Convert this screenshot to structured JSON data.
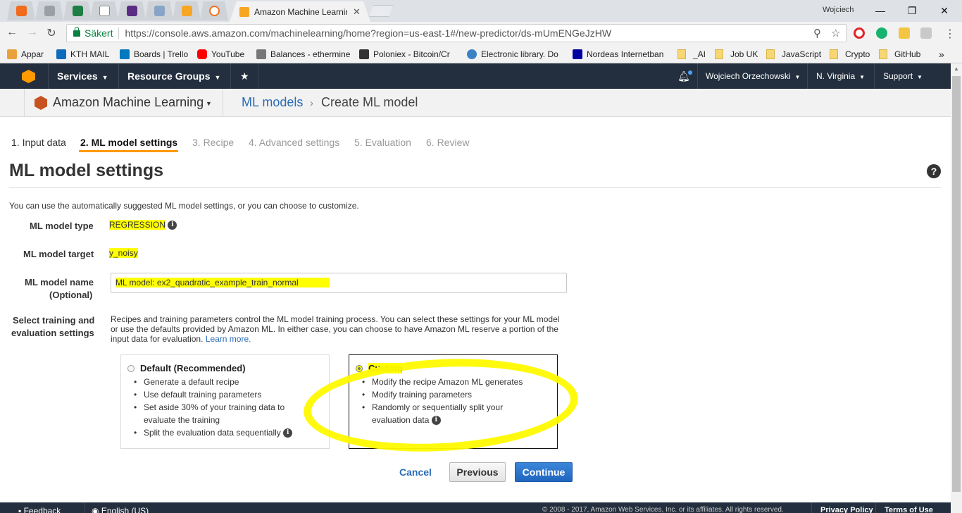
{
  "browser": {
    "active_tab_title": "Amazon Machine Learnin",
    "window_user": "Wojciech",
    "secure_label": "Säkert",
    "url": "https://console.aws.amazon.com/machinelearning/home?region=us-east-1#/new-predictor/ds-mUmENGeJzHW",
    "bookmarks": [
      {
        "label": "Appar",
        "icon_color": "#e9a23b"
      },
      {
        "label": "KTH MAIL",
        "icon_color": "#0f6cbd"
      },
      {
        "label": "Boards | Trello",
        "icon_color": "#0079bf"
      },
      {
        "label": "YouTube",
        "icon_color": "#ff0000"
      },
      {
        "label": "Balances - ethermine",
        "icon_color": "#777777"
      },
      {
        "label": "Poloniex - Bitcoin/Cr",
        "icon_color": "#333333"
      },
      {
        "label": "Electronic library. Do",
        "icon_color": "#3b82c4"
      },
      {
        "label": "Nordeas Internetban",
        "icon_color": "#0000a0"
      },
      {
        "label": "_AI",
        "icon_color": "folder"
      },
      {
        "label": "Job UK",
        "icon_color": "folder"
      },
      {
        "label": "JavaScript",
        "icon_color": "folder"
      },
      {
        "label": "Crypto",
        "icon_color": "folder"
      },
      {
        "label": "GitHub",
        "icon_color": "folder"
      }
    ],
    "overflow": "»"
  },
  "aws_header": {
    "services": "Services",
    "resource_groups": "Resource Groups",
    "user": "Wojciech Orzechowski",
    "region": "N. Virginia",
    "support": "Support"
  },
  "service_header": {
    "service_name": "Amazon Machine Learning",
    "breadcrumb_link": "ML models",
    "breadcrumb_separator": "›",
    "breadcrumb_current": "Create ML model"
  },
  "steps": [
    {
      "label": "1. Input data",
      "state": "done"
    },
    {
      "label": "2. ML model settings",
      "state": "active"
    },
    {
      "label": "3. Recipe",
      "state": "pending"
    },
    {
      "label": "4. Advanced settings",
      "state": "pending"
    },
    {
      "label": "5. Evaluation",
      "state": "pending"
    },
    {
      "label": "6. Review",
      "state": "pending"
    }
  ],
  "page": {
    "title": "ML model settings",
    "intro": "You can use the automatically suggested ML model settings, or you can choose to customize.",
    "model_type_label": "ML model type",
    "model_type_value": "REGRESSION",
    "model_target_label": "ML model target",
    "model_target_value": "y_noisy",
    "model_name_label": "ML model name",
    "model_name_optional": "(Optional)",
    "model_name_value": "ML model: ex2_quadratic_example_train_normal",
    "settings_label_1": "Select training and",
    "settings_label_2": "evaluation settings",
    "settings_desc": "Recipes and training parameters control the ML model training process. You can select these settings for your ML model or use the defaults provided by Amazon ML. In either case, you can choose to have Amazon ML reserve a portion of the input data for evaluation.",
    "learn_more": "Learn more."
  },
  "options": {
    "default": {
      "title": "Default (Recommended)",
      "selected": false,
      "items": [
        "Generate a default recipe",
        "Use default training parameters",
        "Set aside 30% of your training data to evaluate the training",
        "Split the evaluation data sequentially"
      ]
    },
    "custom": {
      "title": "Custom",
      "selected": true,
      "items": [
        "Modify the recipe Amazon ML generates",
        "Modify training parameters",
        "Randomly or sequentially split your evaluation data"
      ]
    }
  },
  "buttons": {
    "cancel": "Cancel",
    "previous": "Previous",
    "continue": "Continue"
  },
  "footer": {
    "feedback": "Feedback",
    "language": "English (US)",
    "copyright": "© 2008 - 2017, Amazon Web Services, Inc. or its affiliates. All rights reserved.",
    "privacy": "Privacy Policy",
    "terms": "Terms of Use"
  },
  "colors": {
    "aws_nav": "#232f3e",
    "accent_orange": "#ff9900",
    "link_blue": "#2b6cb5",
    "highlight_yellow": "#ffff00",
    "primary_button": "#1f66bf"
  }
}
